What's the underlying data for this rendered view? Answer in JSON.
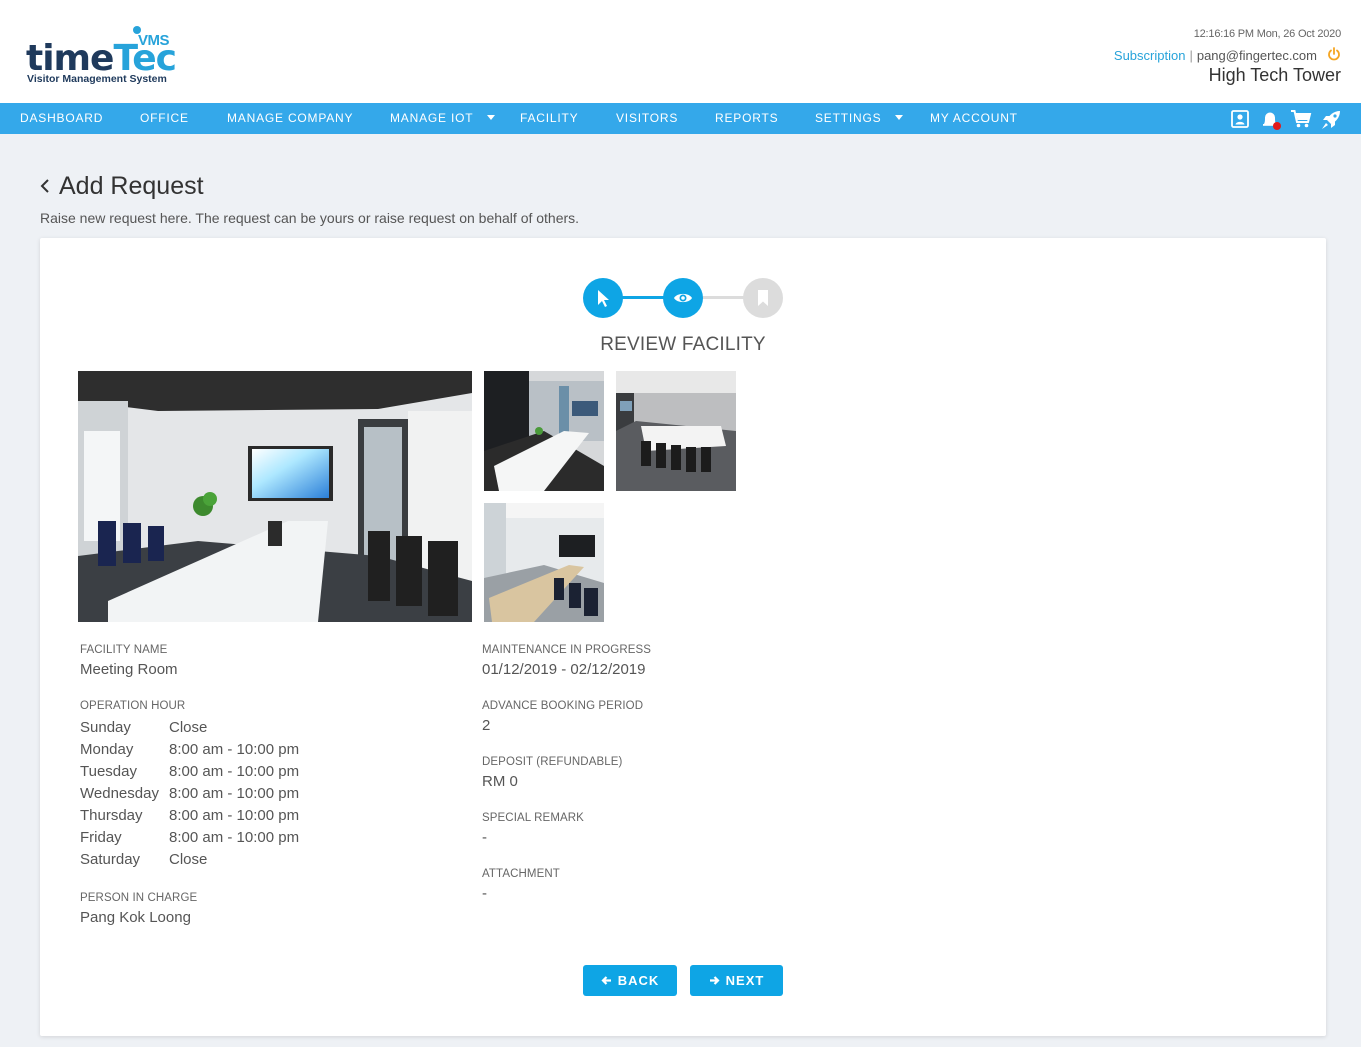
{
  "header": {
    "logo": {
      "word_time": "time",
      "word_tec": "Tec",
      "vms": "VMS",
      "subtitle": "Visitor Management System"
    },
    "clock": "12:16:16 PM  Mon, 26 Oct 2020",
    "subscription": "Subscription",
    "separator": "|",
    "email": "pang@fingertec.com",
    "tower": "High Tech Tower"
  },
  "nav": {
    "items": [
      {
        "label": "DASHBOARD"
      },
      {
        "label": "OFFICE"
      },
      {
        "label": "MANAGE COMPANY"
      },
      {
        "label": "MANAGE IOT"
      },
      {
        "label": "FACILITY"
      },
      {
        "label": "VISITORS"
      },
      {
        "label": "REPORTS"
      },
      {
        "label": "SETTINGS"
      },
      {
        "label": "MY ACCOUNT"
      }
    ],
    "icons": [
      "contact-card-icon",
      "notification-bell-icon",
      "cart-icon",
      "rocket-icon"
    ]
  },
  "page": {
    "title": "Add Request",
    "subtitle": "Raise new request here. The request can be yours or raise request on behalf of others."
  },
  "stepper": {
    "steps": [
      "select-pointer-icon",
      "eye-icon",
      "bookmark-icon"
    ],
    "current_label": "REVIEW FACILITY"
  },
  "facility": {
    "name_label": "FACILITY NAME",
    "name": "Meeting Room",
    "operation_label": "OPERATION HOUR",
    "hours": [
      {
        "day": "Sunday",
        "time": "Close"
      },
      {
        "day": "Monday",
        "time": "8:00 am - 10:00 pm"
      },
      {
        "day": "Tuesday",
        "time": "8:00 am - 10:00 pm"
      },
      {
        "day": "Wednesday",
        "time": "8:00 am - 10:00 pm"
      },
      {
        "day": "Thursday",
        "time": "8:00 am - 10:00 pm"
      },
      {
        "day": "Friday",
        "time": "8:00 am - 10:00 pm"
      },
      {
        "day": "Saturday",
        "time": "Close"
      }
    ],
    "pic_label": "PERSON IN CHARGE",
    "pic": "Pang Kok Loong",
    "maintenance_label": "MAINTENANCE IN PROGRESS",
    "maintenance": "01/12/2019 - 02/12/2019",
    "advance_label": "ADVANCE BOOKING PERIOD",
    "advance": "2",
    "deposit_label": "DEPOSIT (REFUNDABLE)",
    "deposit": "RM 0",
    "remark_label": "SPECIAL REMARK",
    "remark": "-",
    "attachment_label": "ATTACHMENT",
    "attachment": "-"
  },
  "buttons": {
    "back": "BACK",
    "next": "NEXT"
  },
  "colors": {
    "accent": "#0ea5e5",
    "nav": "#34a8ea",
    "brand_dark": "#1f3a5c",
    "power": "#f5a623",
    "badge": "#e01b1b"
  }
}
